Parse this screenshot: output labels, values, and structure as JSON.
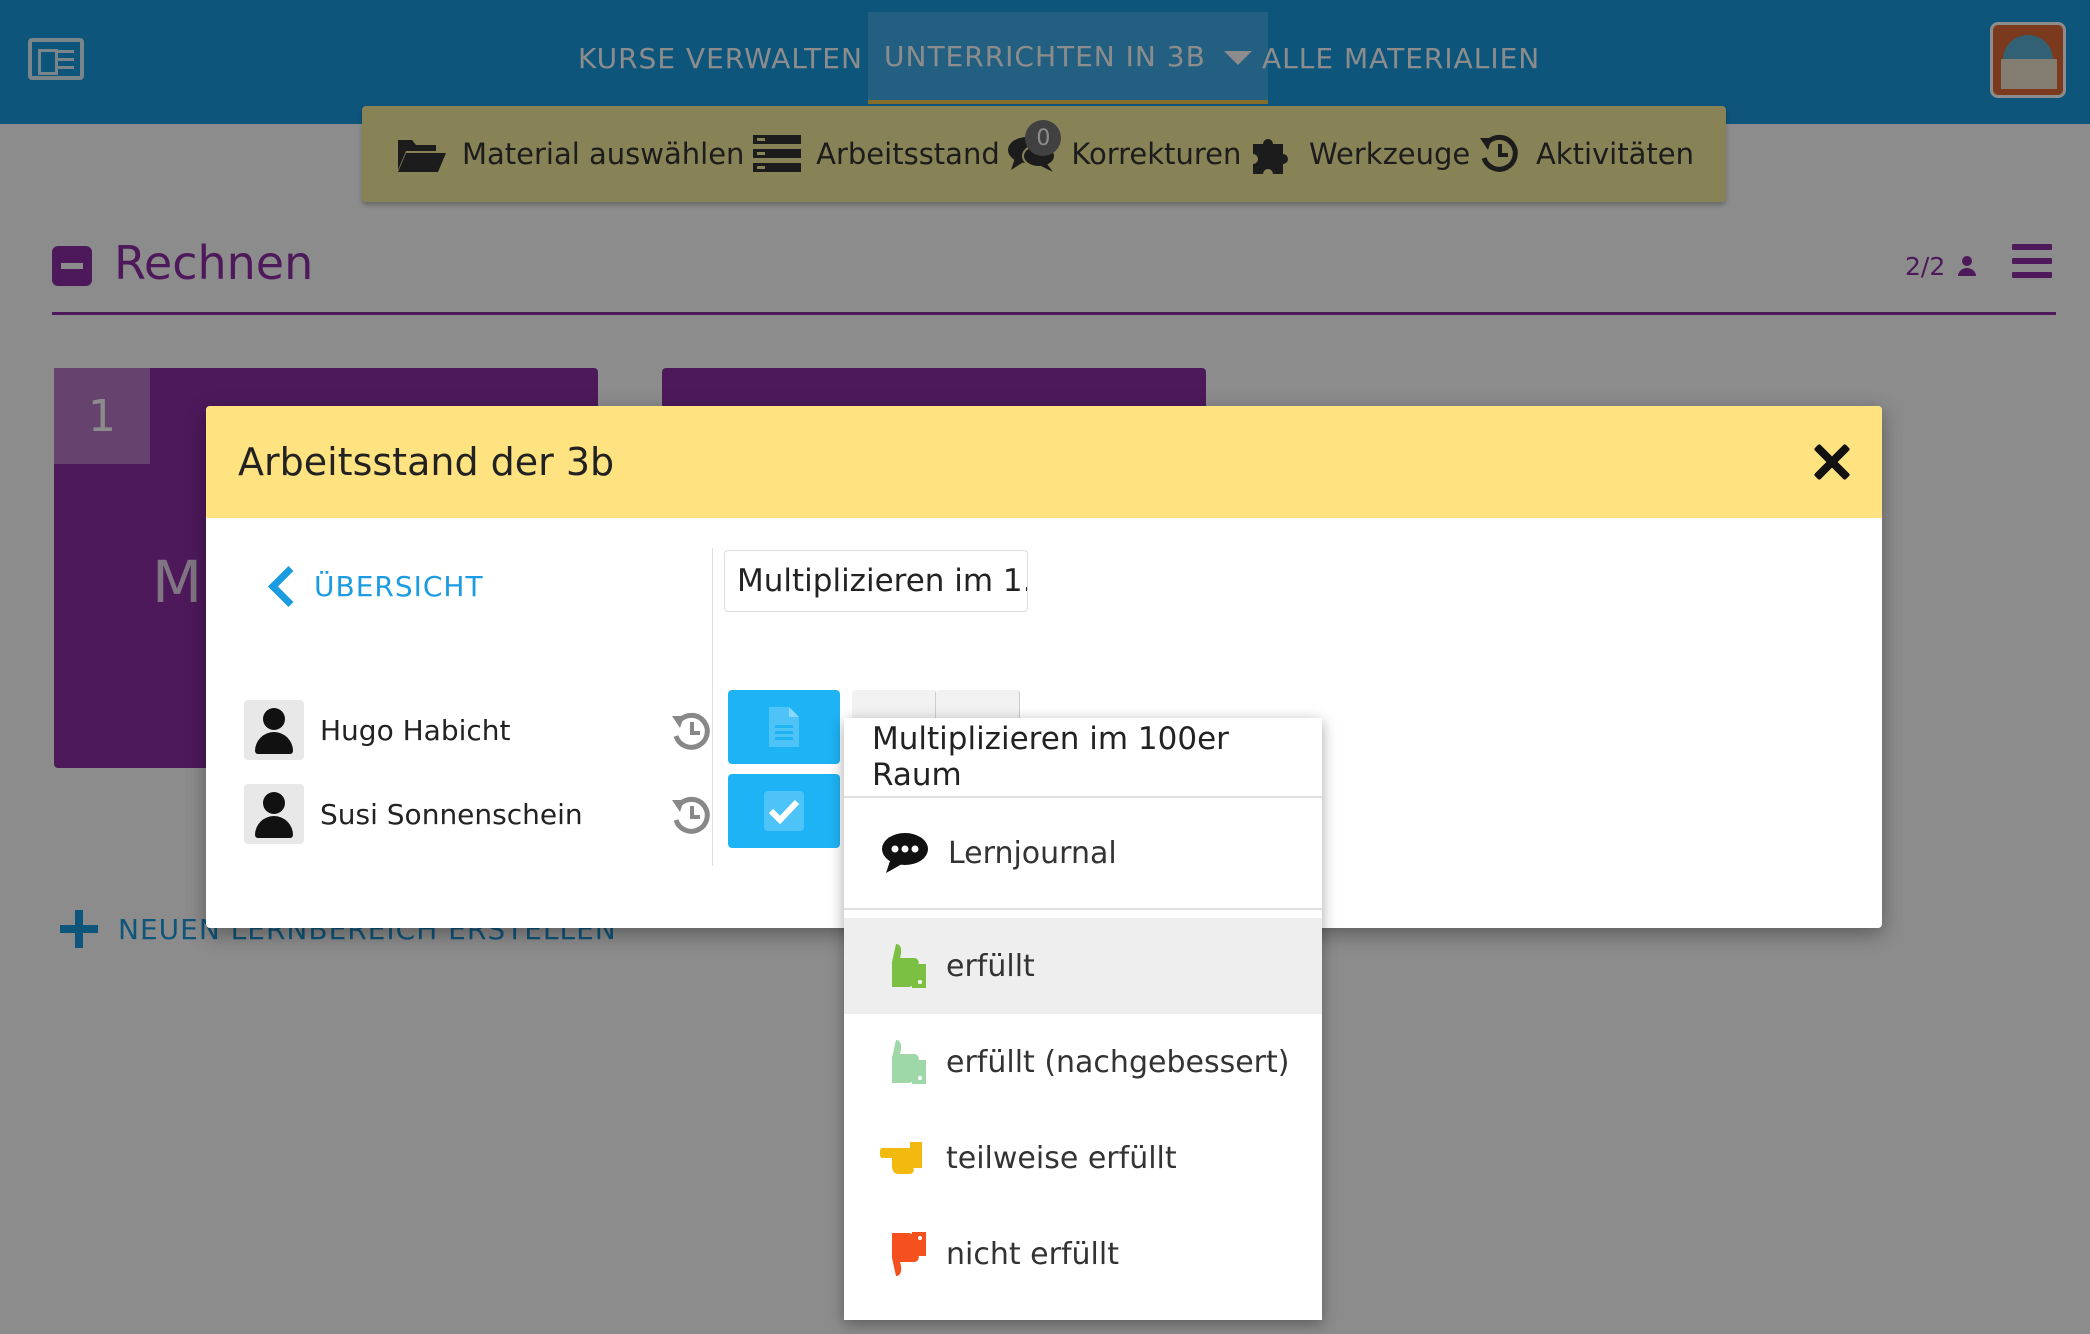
{
  "nav": {
    "items": [
      "KURSE VERWALTEN",
      "UNTERRICHTEN IN 3B",
      "ALLE MATERIALIEN"
    ]
  },
  "toolbar": {
    "items": [
      "Material auswählen",
      "Arbeitsstand",
      "Korrekturen",
      "Werkzeuge",
      "Aktivitäten"
    ],
    "corrections_badge": "0"
  },
  "section": {
    "title": "Rechnen",
    "count": "2/2"
  },
  "cards": {
    "first_number": "1",
    "first_letter": "M"
  },
  "new_area_label": "NEUEN LERNBEREICH ERSTELLEN",
  "modal": {
    "title": "Arbeitsstand der 3b",
    "back_label": "ÜBERSICHT",
    "material_button": "Multiplizieren im 1...",
    "students": [
      "Hugo Habicht",
      "Susi Sonnenschein"
    ]
  },
  "dropdown": {
    "title": "Multiplizieren im 100er Raum",
    "items": [
      "Lernjournal",
      "erfüllt",
      "erfüllt (nachgebessert)",
      "teilweise erfüllt",
      "nicht erfüllt"
    ]
  },
  "colors": {
    "topbar": "#1b9be1",
    "toolbar": "#f7ee9e",
    "accent_purple": "#8e2fa6",
    "modal_header": "#ffe380",
    "status_blue": "#1eb3f5",
    "thumb_green": "#7bc043",
    "thumb_light_green": "#9fd8a8",
    "thumb_yellow": "#f2b90f",
    "thumb_red": "#f4511e"
  }
}
